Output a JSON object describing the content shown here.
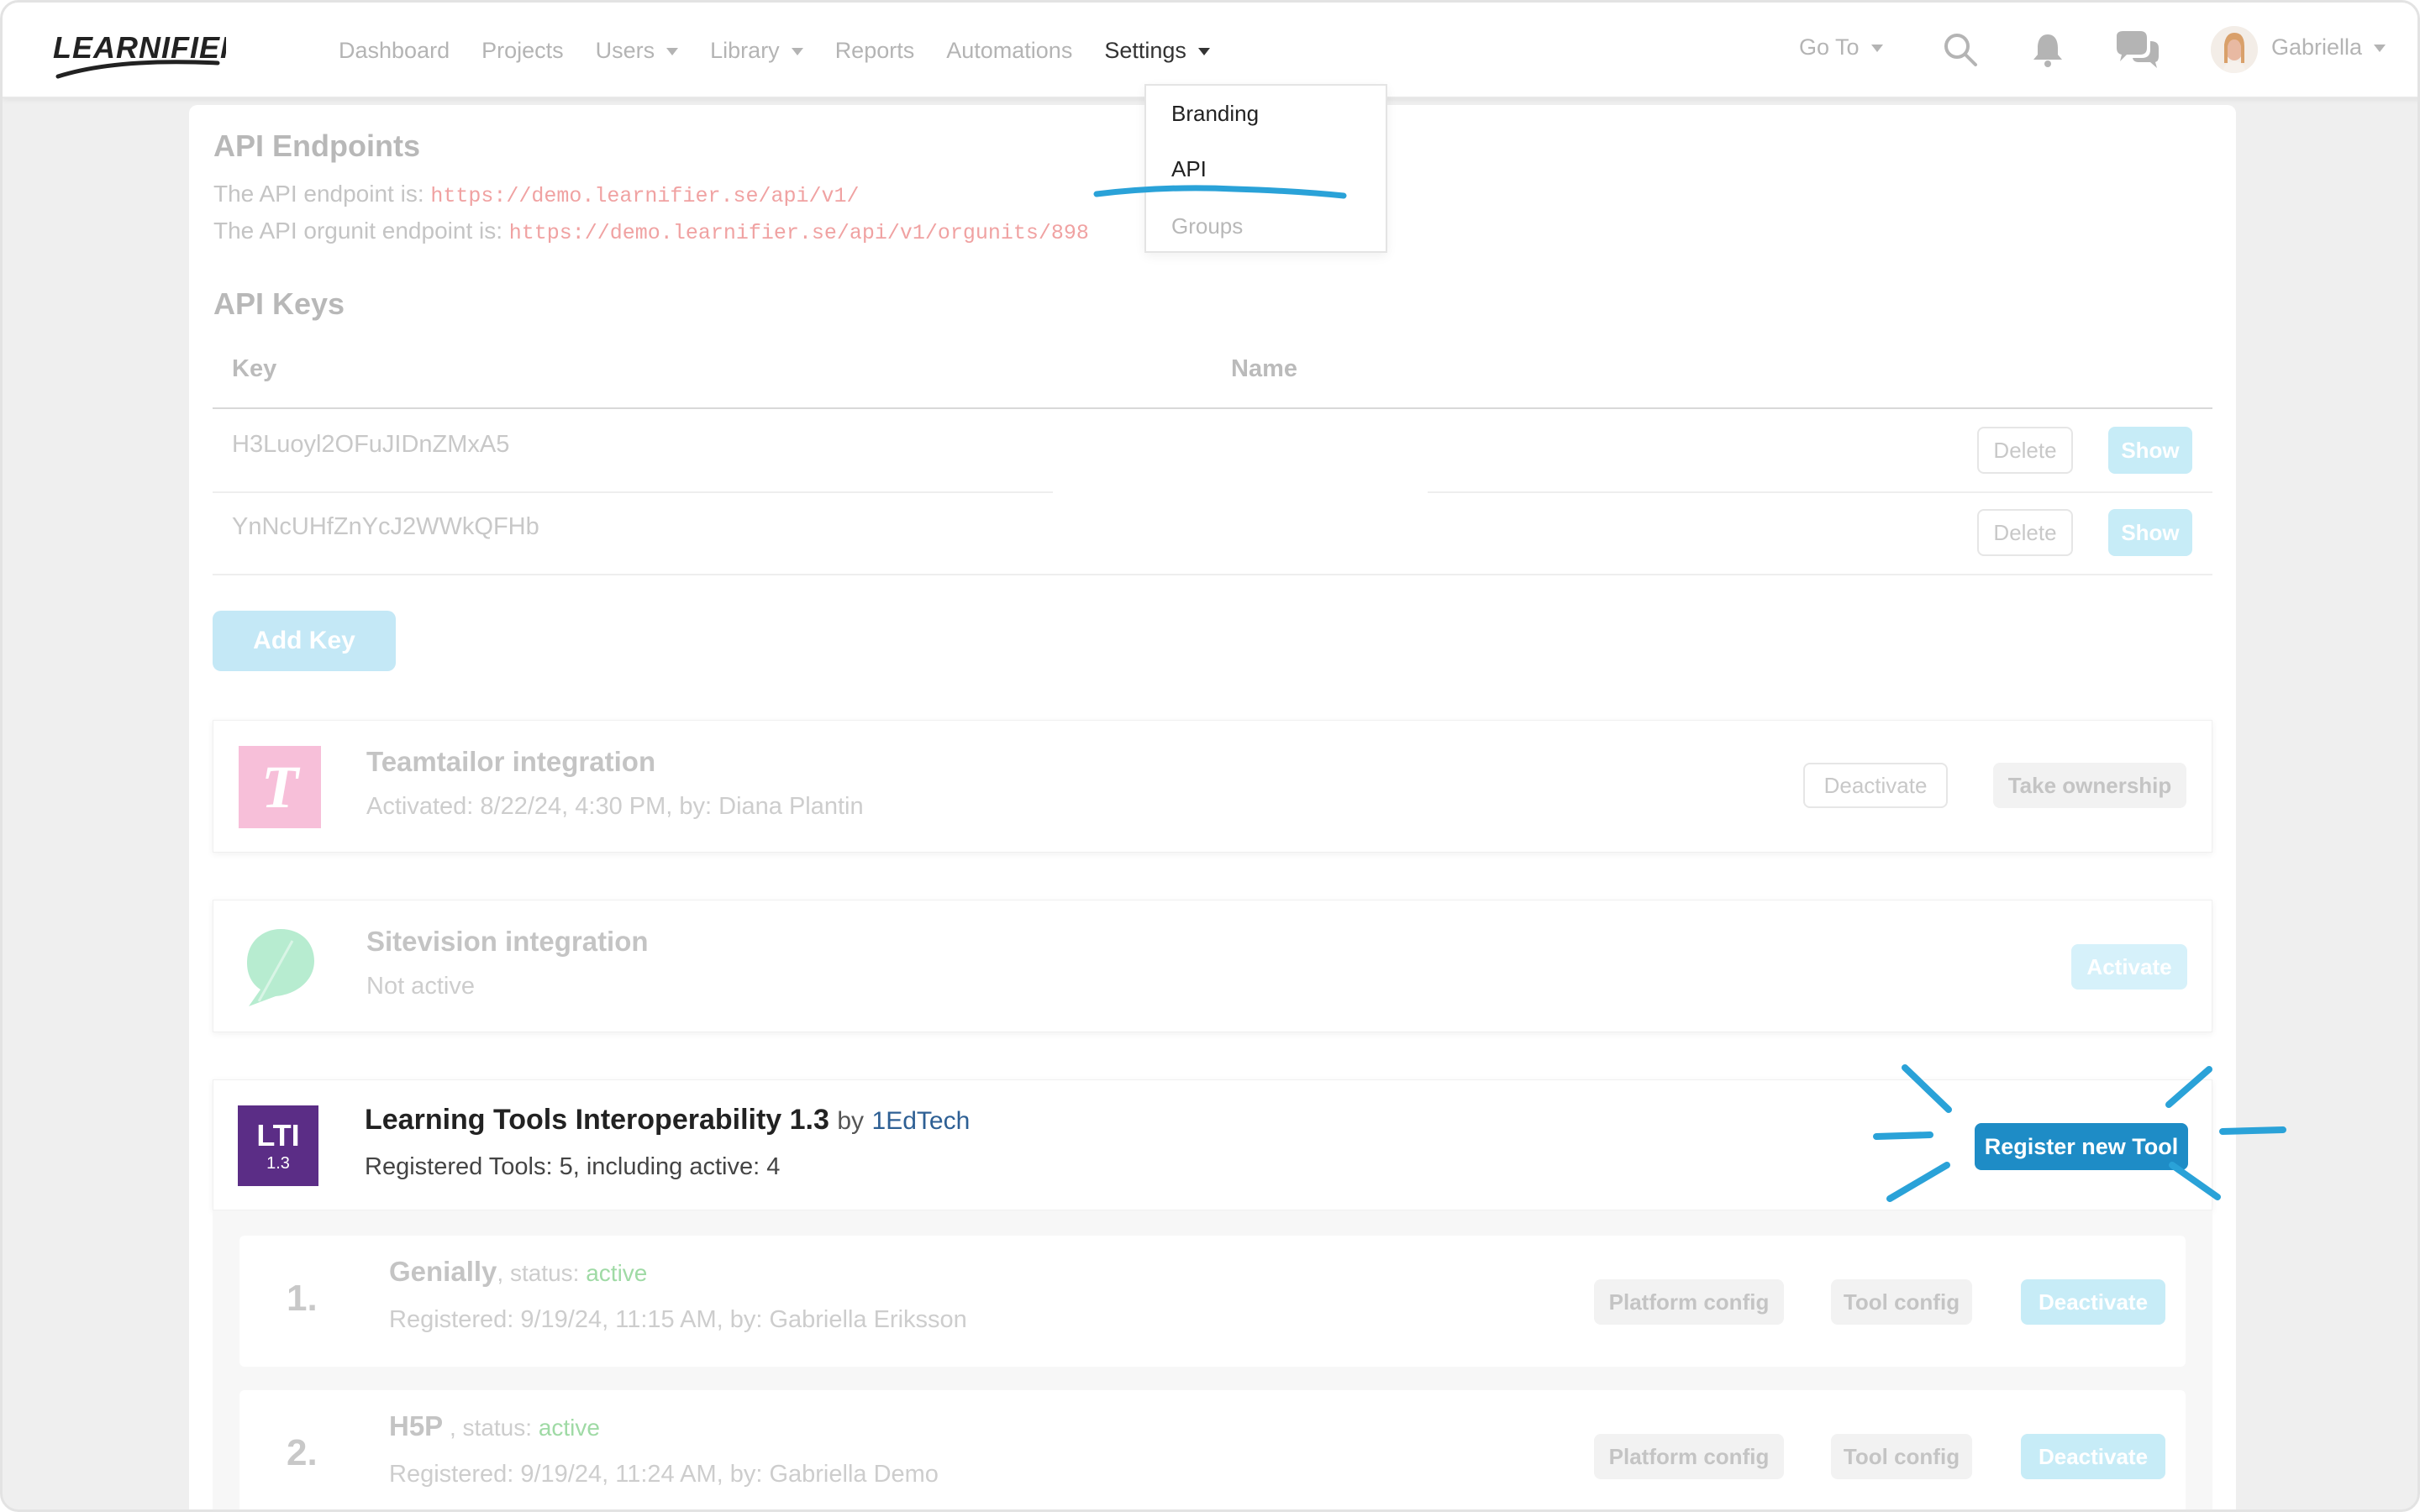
{
  "nav": {
    "logo_text": "LEARNIFIER",
    "links": [
      {
        "label": "Dashboard"
      },
      {
        "label": "Projects"
      },
      {
        "label": "Users"
      },
      {
        "label": "Library"
      },
      {
        "label": "Reports"
      },
      {
        "label": "Automations"
      },
      {
        "label": "Settings"
      }
    ],
    "goto_label": "Go To",
    "user_name": "Gabriella",
    "search_icon": "search-icon",
    "bell_icon": "bell-icon",
    "chat_icon": "chat-icon"
  },
  "settings_menu": {
    "items": [
      {
        "label": "Branding"
      },
      {
        "label": "API"
      },
      {
        "label": "Groups"
      }
    ]
  },
  "endpoints": {
    "title": "API Endpoints",
    "line1_label": "The API endpoint is:",
    "line1_url": "https://demo.learnifier.se/api/v1/",
    "line2_label": "The API orgunit endpoint is:",
    "line2_url": "https://demo.learnifier.se/api/v1/orgunits/898"
  },
  "keys": {
    "title": "API Keys",
    "col_key": "Key",
    "col_name": "Name",
    "rows": [
      {
        "key": "H3Luoyl2OFuJIDnZMxA5",
        "delete": "Delete",
        "show": "Show"
      },
      {
        "key": "YnNcUHfZnYcJ2WWkQFHb",
        "delete": "Delete",
        "show": "Show"
      }
    ],
    "add_label": "Add Key"
  },
  "integrations": {
    "teamtailor": {
      "logo_letter": "T",
      "title": "Teamtailor integration",
      "sub": "Activated: 8/22/24, 4:30 PM, by: Diana Plantin",
      "deactivate": "Deactivate",
      "take_ownership": "Take ownership"
    },
    "sitevision": {
      "title": "Sitevision integration",
      "sub": "Not active",
      "activate": "Activate"
    },
    "lti": {
      "badge_main": "LTI",
      "badge_sub": "1.3",
      "title": "Learning Tools Interoperability 1.3",
      "by": "by",
      "vendor": "1EdTech",
      "sub": "Registered Tools: 5, including active: 4",
      "register": "Register new Tool"
    }
  },
  "tools": [
    {
      "num": "1.",
      "name": "Genially",
      "status_prefix": ", status: ",
      "status": "active",
      "sub": "Registered: 9/19/24, 11:15 AM, by: Gabriella Eriksson",
      "platform": "Platform config",
      "tool": "Tool config",
      "deactivate": "Deactivate"
    },
    {
      "num": "2.",
      "name": "H5P",
      "status_prefix": " , status: ",
      "status": "active",
      "sub": "Registered: 9/19/24, 11:24 AM, by: Gabriella Demo",
      "platform": "Platform config",
      "tool": "Tool config",
      "deactivate": "Deactivate"
    }
  ],
  "colors": {
    "accent": "#1e8cc6",
    "annotation": "#2aa2d8",
    "lti_purple": "#5b2d86",
    "teamtailor_pink": "#f7bfd9",
    "sitevision_green": "#b7ecd0",
    "status_active": "#9fdaa5"
  }
}
